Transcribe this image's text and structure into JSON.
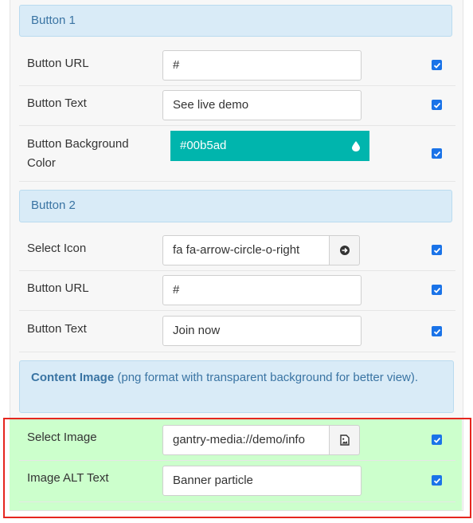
{
  "button1": {
    "header": "Button 1",
    "url_label": "Button URL",
    "url_value": "#",
    "text_label": "Button Text",
    "text_value": "See live demo",
    "bg_label_line1": "Button Background",
    "bg_label_line2": "Color",
    "bg_value": "#00b5ad"
  },
  "button2": {
    "header": "Button 2",
    "icon_label": "Select Icon",
    "icon_value": "fa fa-arrow-circle-o-right",
    "url_label": "Button URL",
    "url_value": "#",
    "text_label": "Button Text",
    "text_value": "Join now"
  },
  "content_image": {
    "title": "Content Image",
    "description": "(png format with transparent background for better view).",
    "select_label": "Select Image",
    "select_value": "gantry-media://demo/info",
    "alt_label": "Image ALT Text",
    "alt_value": "Banner particle"
  },
  "colors": {
    "accent": "#00b5ad",
    "header_bg": "#d9ebf7",
    "highlight_border": "#e5261f",
    "highlight_bg": "#ccffcc",
    "checkbox": "#1a73e8"
  },
  "icons": {
    "color_picker": "water-drop-icon",
    "icon_picker": "arrow-circle-right-icon",
    "image_picker": "image-icon",
    "checkbox": "checkmark-icon"
  }
}
